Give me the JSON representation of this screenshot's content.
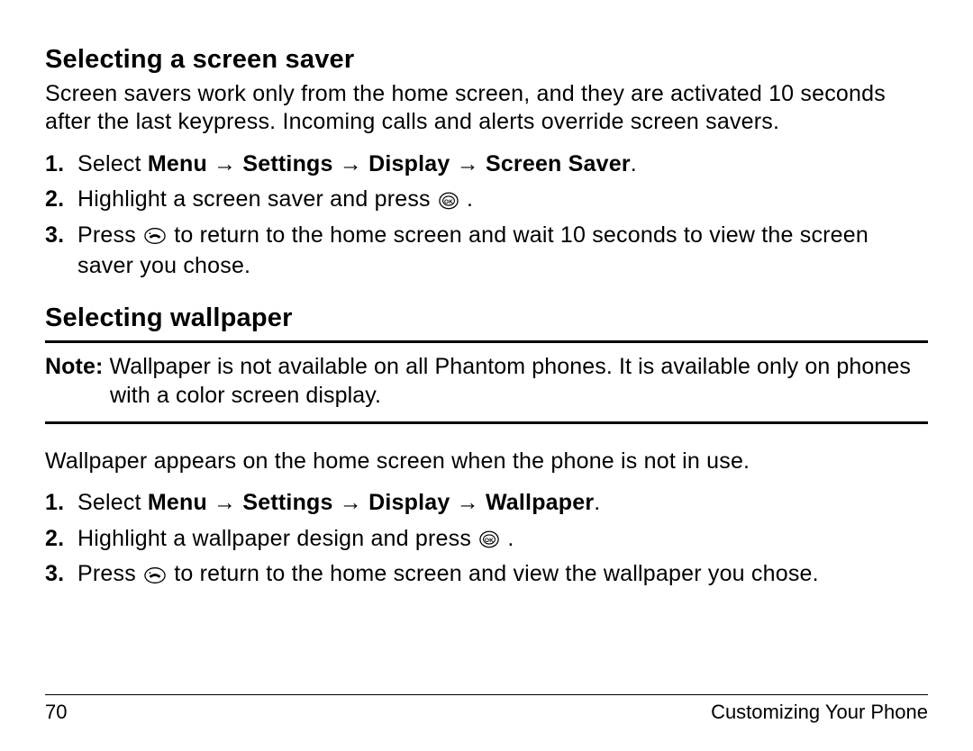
{
  "section1": {
    "heading": "Selecting a screen saver",
    "intro": "Screen savers work only from the home screen, and they are activated 10 seconds after the last keypress. Incoming calls and alerts override screen savers.",
    "steps": [
      {
        "num": "1.",
        "prefix": "Select ",
        "boldpath": "Menu → Settings → Display → Screen Saver",
        "suffix": "."
      },
      {
        "num": "2.",
        "prefix": "Highlight a screen saver and press ",
        "icon": "ok",
        "suffix": " ."
      },
      {
        "num": "3.",
        "prefix": "Press ",
        "icon": "end",
        "suffix": "  to return to the home screen and wait 10 seconds to view the screen saver you chose."
      }
    ]
  },
  "section2": {
    "heading": "Selecting wallpaper",
    "note_label": "Note: ",
    "note_text": "Wallpaper is not available on all Phantom phones. It is available only on phones with a color screen display.",
    "intro": "Wallpaper appears on the home screen when the phone is not in use.",
    "steps": [
      {
        "num": "1.",
        "prefix": "Select ",
        "boldpath": "Menu → Settings → Display → Wallpaper",
        "suffix": "."
      },
      {
        "num": "2.",
        "prefix": "Highlight a wallpaper design and press ",
        "icon": "ok",
        "suffix": " ."
      },
      {
        "num": "3.",
        "prefix": "Press ",
        "icon": "end",
        "suffix": "  to return to the home screen and view the wallpaper you chose."
      }
    ]
  },
  "footer": {
    "page_number": "70",
    "chapter": "Customizing Your Phone"
  }
}
